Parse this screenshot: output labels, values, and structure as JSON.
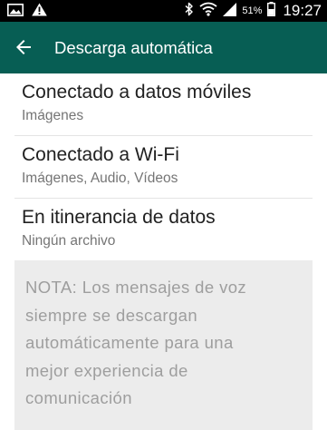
{
  "status_bar": {
    "battery_percent": "51%",
    "time": "19:27",
    "icons": [
      "image-icon",
      "warning-icon",
      "bluetooth-icon",
      "wifi-icon",
      "signal-icon",
      "battery-icon"
    ]
  },
  "app_bar": {
    "title": "Descarga automática",
    "back_icon": "arrow-back-icon",
    "color": "#075e54"
  },
  "settings": {
    "items": [
      {
        "title": "Conectado a datos móviles",
        "subtitle": "Imágenes"
      },
      {
        "title": "Conectado a Wi-Fi",
        "subtitle": "Imágenes, Audio, Vídeos"
      },
      {
        "title": "En itinerancia de datos",
        "subtitle": "Ningún archivo"
      }
    ]
  },
  "note": {
    "lines": [
      "NOTA: Los mensajes de voz",
      "siempre se descargan",
      "automáticamente para una",
      "mejor experiencia de",
      "comunicación"
    ]
  }
}
